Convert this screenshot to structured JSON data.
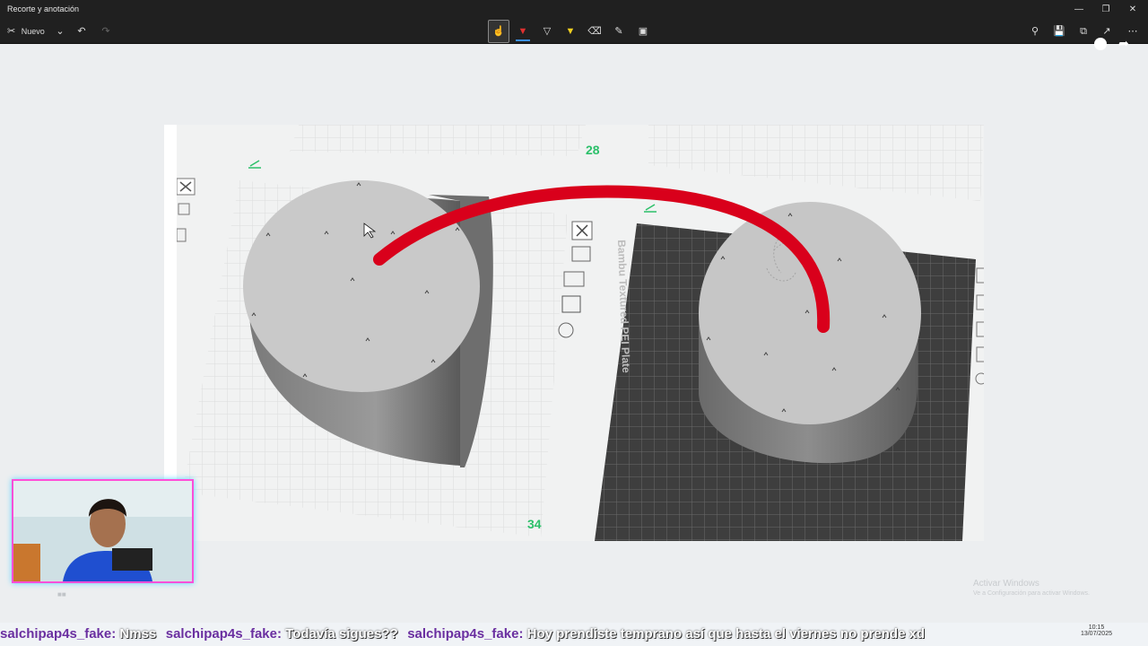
{
  "window": {
    "title": "Recorte y anotación",
    "controls": [
      "minimize-icon",
      "maximize-icon",
      "close-icon"
    ]
  },
  "toolbar": {
    "new_label": "Nuevo",
    "new_icon": "snip-icon",
    "left_icons": [
      "chevron-down-icon",
      "undo-icon",
      "redo-icon"
    ],
    "center_tools": [
      "touch-writing-icon",
      "ballpoint-pen-icon",
      "pencil-icon",
      "highlighter-icon",
      "eraser-icon",
      "ruler-icon",
      "crop-icon"
    ],
    "right_icons": [
      "zoom-icon",
      "save-icon",
      "copy-icon",
      "share-icon",
      "more-icon"
    ],
    "active_pen_color": "#e03030",
    "highlighter_color": "#f0d020"
  },
  "scene": {
    "plate_number_top": "28",
    "plate_number_bottom": "34",
    "plate_label": "Bambu Textured PEI Plate",
    "annotation_color": "#d9001b",
    "accent_green": "#2cc06a"
  },
  "overlay": {
    "activate_title": "Activar Windows",
    "activate_sub": "Ve a Configuración para activar Windows."
  },
  "ticker": {
    "items": [
      {
        "user": "salchipap4s_fake:",
        "message": "Nmss"
      },
      {
        "user": "salchipap4s_fake:",
        "message": "Todavía sigues??"
      },
      {
        "user": "salchipap4s_fake:",
        "message": "Hoy prendiste temprano así que hasta el viernes no prende xd"
      }
    ]
  },
  "tray": {
    "time": "10:15",
    "date": "13/07/2025"
  }
}
